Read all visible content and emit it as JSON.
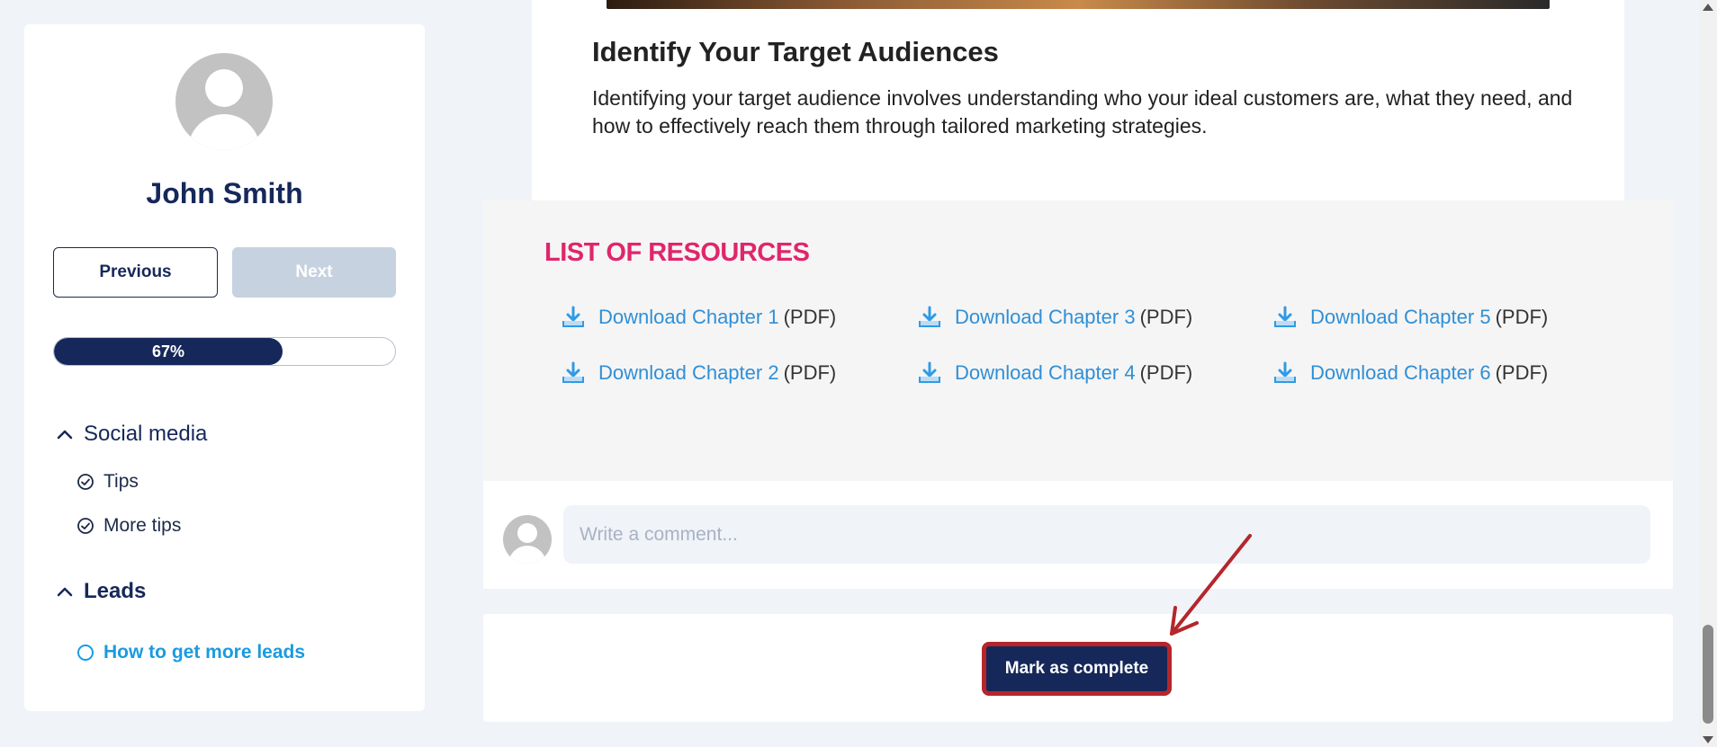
{
  "sidebar": {
    "user_name": "John Smith",
    "prev_label": "Previous",
    "next_label": "Next",
    "progress": {
      "percent": 67,
      "label": "67%"
    },
    "sections": [
      {
        "title": "Social media",
        "items": [
          "Tips",
          "More tips"
        ]
      },
      {
        "title": "Leads",
        "items": [
          "How to get more leads"
        ]
      }
    ]
  },
  "article": {
    "title": "Identify Your Target Audiences",
    "text": "Identifying your target audience involves understanding who your ideal customers are, what they need, and how to effectively reach them through tailored marketing strategies."
  },
  "resources": {
    "title": "LIST OF RESOURCES",
    "suffix": "(PDF)",
    "items": [
      "Download Chapter 1",
      "Download Chapter 2",
      "Download Chapter 3",
      "Download Chapter 4",
      "Download Chapter 5",
      "Download Chapter 6"
    ]
  },
  "comment": {
    "placeholder": "Write a comment..."
  },
  "complete": {
    "label": "Mark as complete"
  },
  "colors": {
    "navy": "#16285a",
    "accent_pink": "#e0266b",
    "link_blue": "#2f8fd6",
    "active_blue": "#1a9be0",
    "annotation_red": "#b5262b"
  },
  "icons": [
    "user-avatar-icon",
    "chevron-up-icon",
    "check-circle-icon",
    "circle-icon",
    "download-icon",
    "red-arrow-annotation"
  ]
}
